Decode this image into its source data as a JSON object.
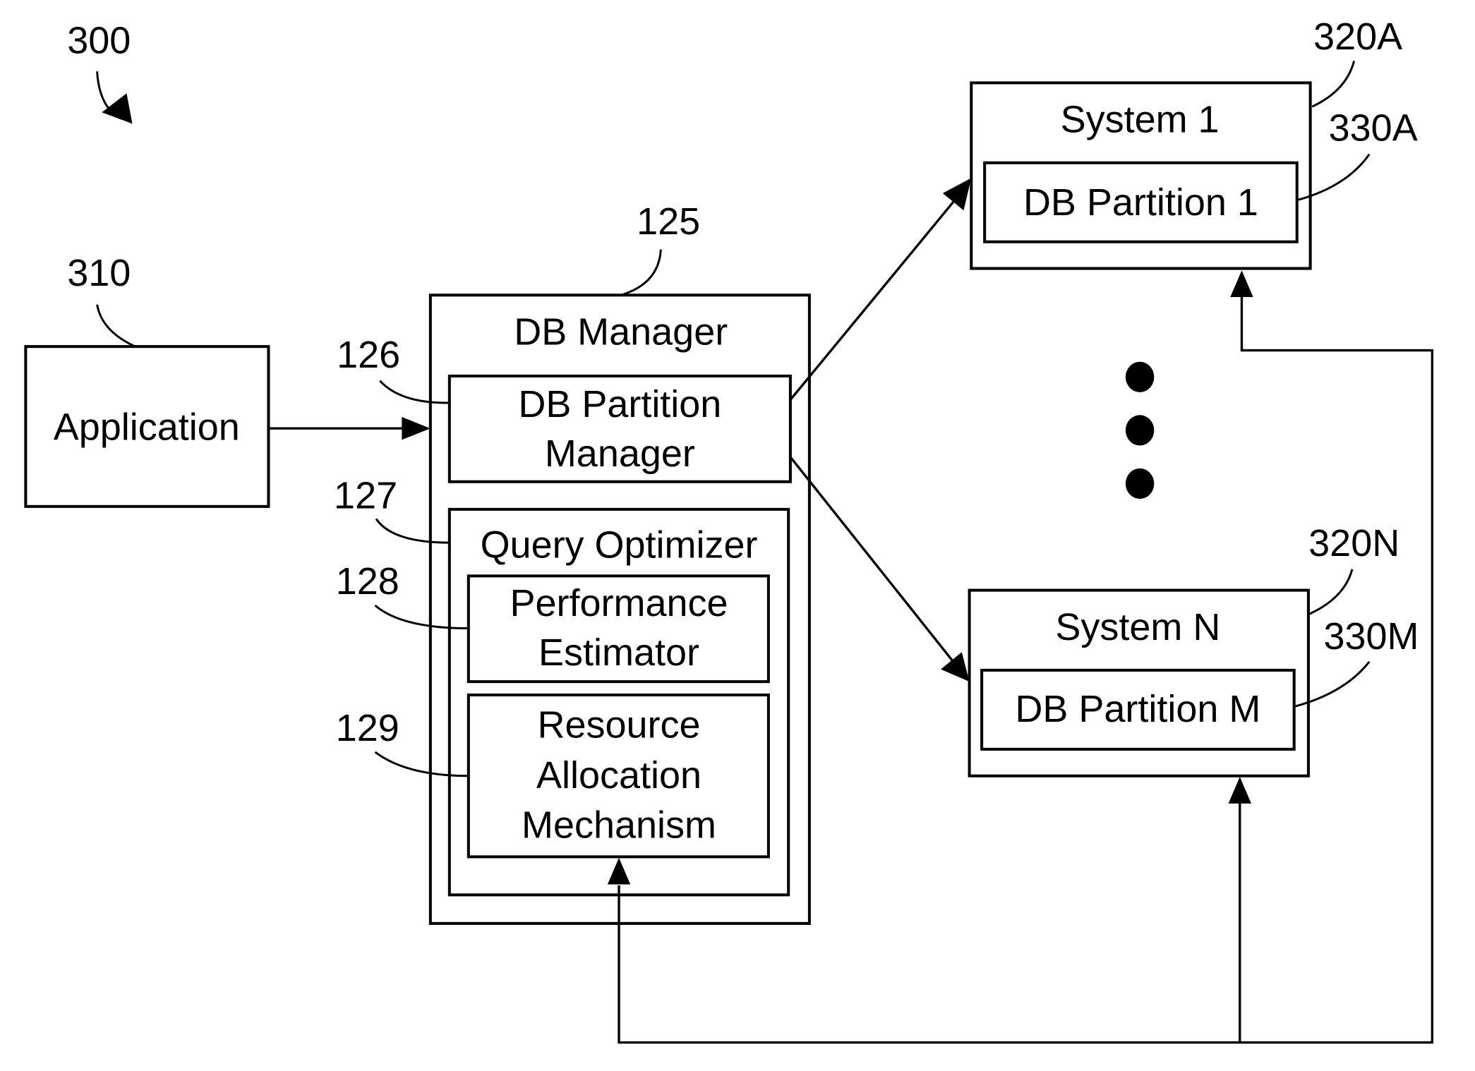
{
  "figure": {
    "ref_number": "300",
    "nodes": {
      "application": {
        "ref": "310",
        "label": "Application"
      },
      "db_manager": {
        "ref": "125",
        "label": "DB Manager"
      },
      "db_partition_manager": {
        "ref": "126",
        "label_line1": "DB Partition",
        "label_line2": "Manager"
      },
      "query_optimizer": {
        "ref": "127",
        "label": "Query Optimizer"
      },
      "performance_estimator": {
        "ref": "128",
        "label_line1": "Performance",
        "label_line2": "Estimator"
      },
      "resource_allocation": {
        "ref": "129",
        "label_line1": "Resource",
        "label_line2": "Allocation",
        "label_line3": "Mechanism"
      },
      "system_1": {
        "ref": "320A",
        "label": "System 1"
      },
      "db_partition_1": {
        "ref": "330A",
        "label": "DB Partition 1"
      },
      "system_n": {
        "ref": "320N",
        "label": "System N"
      },
      "db_partition_m": {
        "ref": "330M",
        "label": "DB Partition M"
      }
    },
    "edges": [
      {
        "from": "Application",
        "to": "DB Manager"
      },
      {
        "from": "DB Partition Manager",
        "to": "System 1"
      },
      {
        "from": "DB Partition Manager",
        "to": "System N"
      },
      {
        "from": "System 1",
        "to": "Resource Allocation Mechanism"
      },
      {
        "from": "System N",
        "to": "Resource Allocation Mechanism"
      }
    ],
    "ellipsis": "vertical dots between System 1 and System N"
  }
}
